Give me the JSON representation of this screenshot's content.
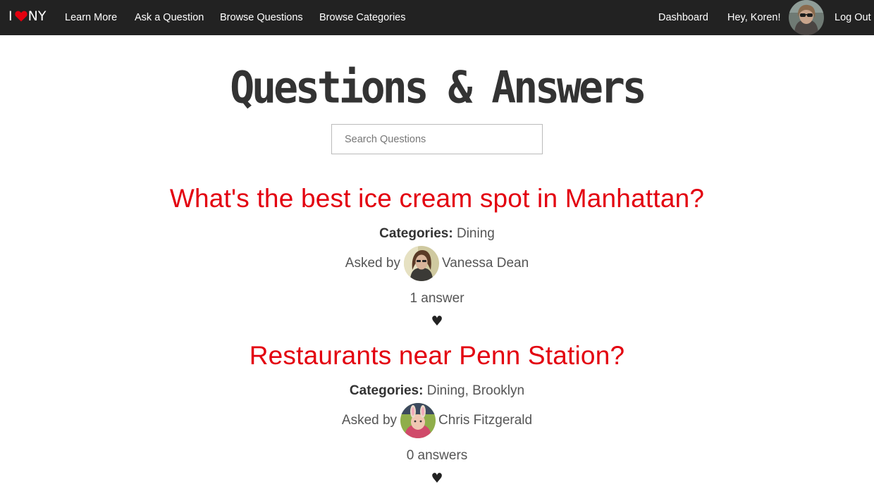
{
  "nav": {
    "logo": {
      "prefix": "I",
      "suffix": "NY",
      "heart_color": "#e3000f"
    },
    "links": [
      {
        "label": "Learn More"
      },
      {
        "label": "Ask a Question"
      },
      {
        "label": "Browse Questions"
      },
      {
        "label": "Browse Categories"
      }
    ],
    "right": {
      "dashboard": "Dashboard",
      "greeting": "Hey, Koren!",
      "logout": "Log Out"
    },
    "background": "#222222"
  },
  "page": {
    "title": "Questions & Answers",
    "search_placeholder": "Search Questions"
  },
  "questions": [
    {
      "title": "What's the best ice cream spot in Manhattan?",
      "categories_label": "Categories:",
      "categories": "Dining",
      "asked_by_label": "Asked by",
      "author": "Vanessa Dean",
      "answers": "1 answer",
      "fav_icon": "♥"
    },
    {
      "title": "Restaurants near Penn Station?",
      "categories_label": "Categories:",
      "categories": "Dining, Brooklyn",
      "asked_by_label": "Asked by",
      "author": "Chris Fitzgerald",
      "answers": "0 answers",
      "fav_icon": "♥"
    }
  ],
  "colors": {
    "accent": "#e3000f",
    "text": "#333333"
  }
}
